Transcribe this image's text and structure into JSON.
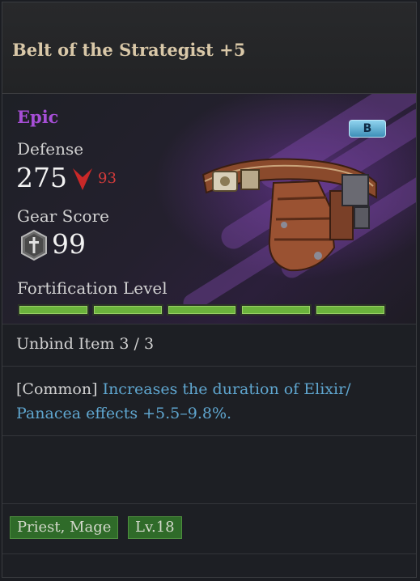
{
  "item": {
    "name": "Belt of the Strategist +5",
    "rarity": "Epic",
    "rarity_color": "#a64ed6",
    "grade_badge": "B",
    "defense_label": "Defense",
    "defense_value": "275",
    "defense_diff": "93",
    "defense_diff_direction": "down",
    "gear_score_label": "Gear Score",
    "gear_score_value": "99",
    "fortification_label": "Fortification Level",
    "fortification_filled": 5,
    "fortification_total": 5,
    "unbind_text": "Unbind Item 3 / 3",
    "effect_prefix": "[Common]",
    "effect_text": "Increases the duration of Elixir/ Panacea effects +5.5–9.8%.",
    "effect_color": "#5fa6cf",
    "classes": "Priest, Mage",
    "level_req": "Lv.18",
    "item_image": "leather-belt"
  }
}
